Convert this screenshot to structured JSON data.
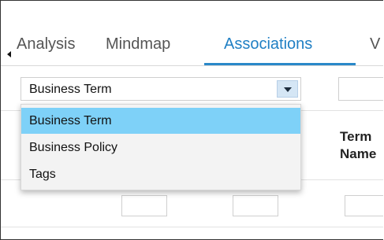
{
  "tabs": [
    {
      "label": "Analysis"
    },
    {
      "label": "Mindmap"
    },
    {
      "label": "Associations"
    },
    {
      "label": "V"
    }
  ],
  "filter": {
    "selected": "Business Term",
    "options": [
      "Business Term",
      "Business Policy",
      "Tags"
    ]
  },
  "table": {
    "column_header": "Term\nName"
  },
  "colors": {
    "active_tab": "#1f7fc4",
    "selected_option": "#7ed1f8"
  }
}
